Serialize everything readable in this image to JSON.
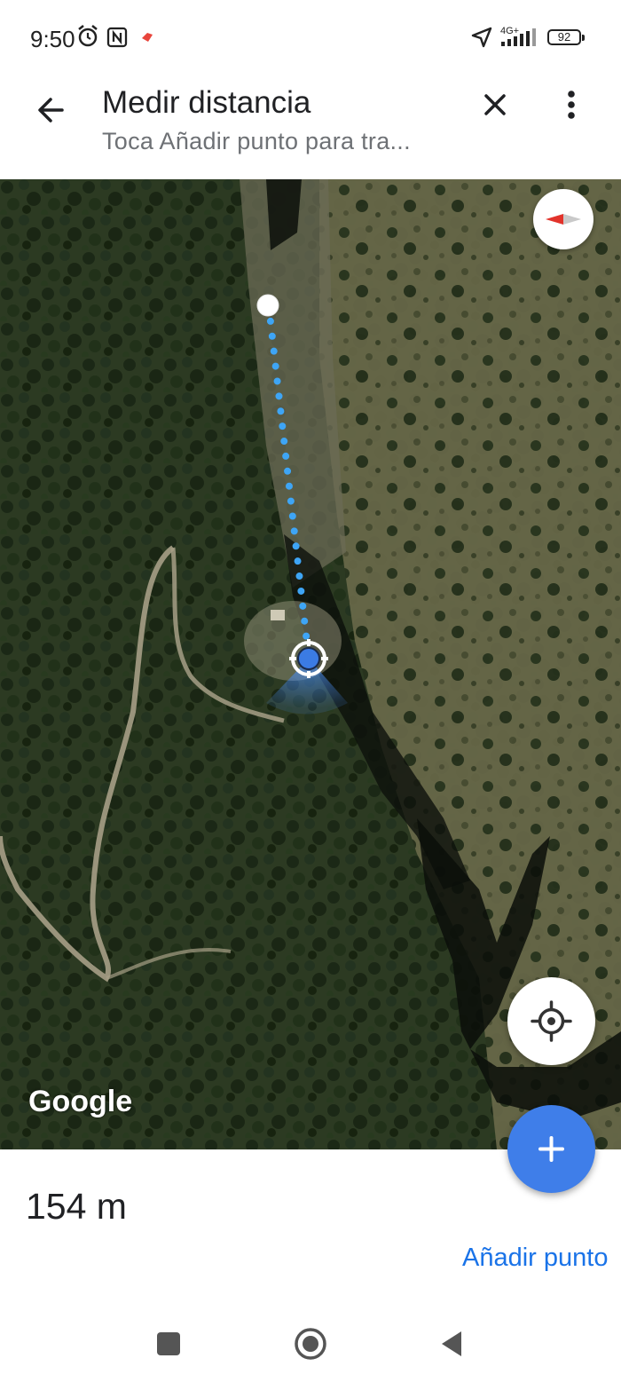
{
  "status_bar": {
    "time": "9:50",
    "network": "4G+",
    "battery": "92",
    "icons": [
      "alarm-icon",
      "nfc-icon",
      "app-notification-icon",
      "location-arrow-icon",
      "signal-icon",
      "battery-icon"
    ]
  },
  "header": {
    "title": "Medir distancia",
    "subtitle": "Toca Añadir punto para tra...",
    "back_icon": "arrow-left-icon",
    "close_icon": "close-icon",
    "more_icon": "more-vert-icon"
  },
  "map": {
    "imagery": "satellite",
    "attribution": "Google",
    "measure_line_color": "#3ea5f5",
    "user_location_color": "#3b7be3"
  },
  "controls": {
    "compass_icon": "compass-icon",
    "locate_icon": "my-location-icon",
    "add_icon": "plus-icon",
    "accent": "#3f7ee9"
  },
  "measurement": {
    "distance": "154 m",
    "add_point_label": "Añadir punto"
  },
  "nav_bar": {
    "icons": [
      "recents-square-icon",
      "home-circle-icon",
      "back-triangle-icon"
    ]
  }
}
